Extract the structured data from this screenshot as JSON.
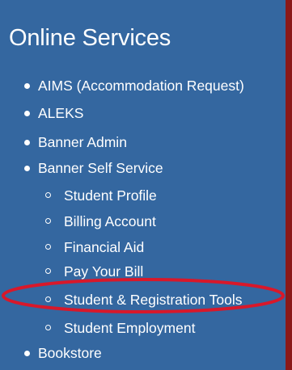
{
  "panel": {
    "title": "Online Services",
    "background_color": "#3467a0",
    "border_color": "#8a1919"
  },
  "menu": {
    "items": [
      {
        "label": "AIMS (Accommodation Request)"
      },
      {
        "label": "ALEKS"
      },
      {
        "label": "Banner Admin"
      },
      {
        "label": "Banner Self Service"
      },
      {
        "label": "Bookstore"
      }
    ],
    "sub_items": [
      {
        "label": "Student Profile"
      },
      {
        "label": "Billing Account"
      },
      {
        "label": "Financial Aid"
      },
      {
        "label": "Pay Your Bill"
      },
      {
        "label": "Student & Registration Tools"
      },
      {
        "label": "Student Employment"
      }
    ]
  },
  "highlight": {
    "target": "Student & Registration Tools",
    "color": "#d8182a"
  }
}
